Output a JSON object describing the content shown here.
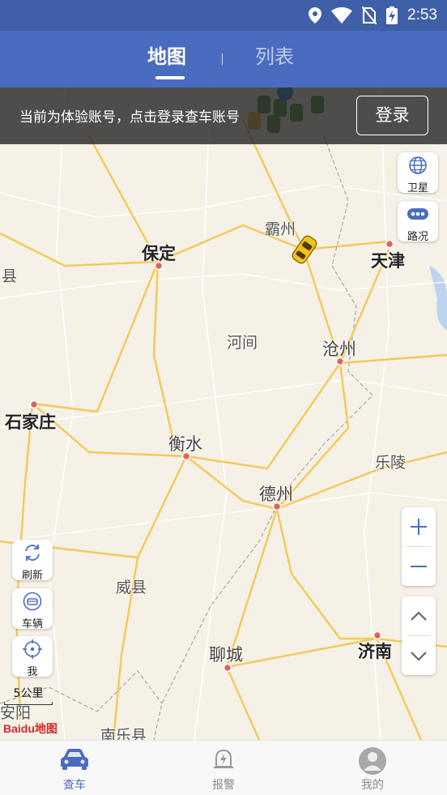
{
  "status_bar": {
    "time": "2:53",
    "icons": [
      "location-icon",
      "wifi-icon",
      "no-sim-icon",
      "battery-charging-icon"
    ]
  },
  "header": {
    "tabs": [
      {
        "label": "地图",
        "active": true
      },
      {
        "label": "列表",
        "active": false
      }
    ]
  },
  "guest_banner": {
    "message": "当前为体验账号，点击登录查车账号",
    "login_label": "登录"
  },
  "map_controls": {
    "satellite_label": "卫星",
    "traffic_label": "路况",
    "refresh_label": "刷新",
    "vehicles_label": "车辆",
    "me_label": "我",
    "zoom_in_icon": "plus-icon",
    "zoom_out_icon": "minus-icon",
    "pan_up_icon": "chevron-up-icon",
    "pan_down_icon": "chevron-down-icon"
  },
  "map": {
    "scale_label": "5公里",
    "logo_text": "Baidu地图",
    "cities": [
      "保定",
      "天津",
      "石家庄",
      "沧州",
      "衡水",
      "德州",
      "聊城",
      "济南",
      "霸州"
    ],
    "towns": [
      "河间",
      "乐陵",
      "威县",
      "安阳",
      "南乐县",
      "县"
    ]
  },
  "bottom_nav": [
    {
      "label": "查车",
      "icon": "car-icon",
      "active": true
    },
    {
      "label": "报警",
      "icon": "alarm-bell-icon",
      "active": false
    },
    {
      "label": "我的",
      "icon": "user-profile-icon",
      "active": false
    }
  ],
  "colors": {
    "primary": "#4a6cc0",
    "status_bar": "#3f5fa8",
    "road_major": "#f3c957",
    "map_bg": "#f6f1e6"
  }
}
